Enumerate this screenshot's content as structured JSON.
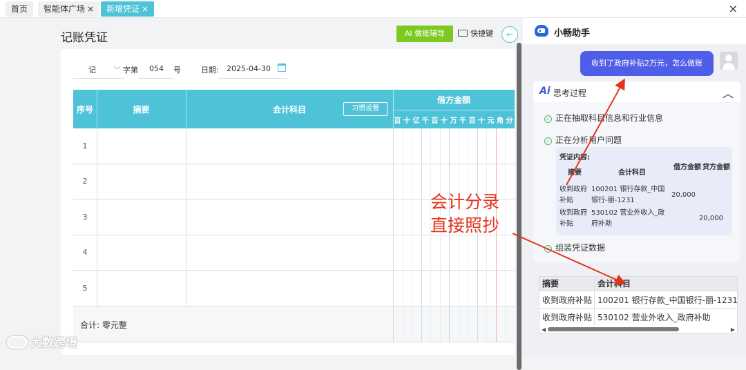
{
  "tabs": [
    {
      "label": "首页",
      "closable": false,
      "active": false
    },
    {
      "label": "智能体广场",
      "closable": true,
      "active": false
    },
    {
      "label": "新增凭证",
      "closable": true,
      "active": true
    }
  ],
  "tab_close_glyph": "×",
  "window_close_glyph": "×",
  "voucher": {
    "title": "记账凭证",
    "ai_button": "AI 做账辅导",
    "shortcut_button": "快捷键",
    "back_icon": "←",
    "word_type": "记",
    "word_label": "字第",
    "number": "054",
    "number_unit": "号",
    "date_label": "日期:",
    "date": "2025-04-30",
    "columns": {
      "seq": "序号",
      "summary": "摘要",
      "account": "会计科目",
      "habit_settings": "习惯设置",
      "debit": "借方金额",
      "digits": [
        "百",
        "十",
        "亿",
        "千",
        "百",
        "十",
        "万",
        "千",
        "百",
        "十",
        "元",
        "角",
        "分"
      ]
    },
    "rows": [
      "1",
      "2",
      "3",
      "4",
      "5"
    ],
    "total_label": "合计: 零元整"
  },
  "assistant": {
    "title": "小畅助手",
    "user_message": "收到了政府补贴2万元，怎么做账",
    "thinking_title": "思考过程",
    "ai_icon": "Ai",
    "collapse_icon": "︿",
    "check_glyph": "✓",
    "steps": [
      "正在抽取科目信息和行业信息",
      "正在分析用户问题",
      "组装凭证数据"
    ],
    "voucher_content_label": "凭证内容:",
    "voucher_headers": {
      "summary": "摘要",
      "account": "会计科目",
      "debit": "借方金额",
      "credit": "贷方金额"
    },
    "voucher_rows": [
      {
        "summary": "收到政府补贴",
        "account": "100201 银行存款_中国银行-丽-1231",
        "debit": "20,000",
        "credit": ""
      },
      {
        "summary": "收到政府补贴",
        "account": "530102 营业外收入_政府补助",
        "debit": "",
        "credit": "20,000"
      }
    ],
    "result_headers": {
      "summary": "摘要",
      "account": "会计科目"
    },
    "result_rows": [
      {
        "summary": "收到政府补贴",
        "account": "100201 银行存款_中国银行-丽-1231"
      },
      {
        "summary": "收到政府补贴",
        "account": "530102 营业外收入_政府补助"
      }
    ],
    "scroll_left": "◀",
    "scroll_right": "▶"
  },
  "annotation": {
    "line1": "会计分录",
    "line2": "直接照抄",
    "color": "#e5331b"
  },
  "watermark": "大数跨境",
  "colors": {
    "header_cyan": "#4ec3d8",
    "ai_green": "#7cc91f",
    "bubble_blue": "#4f5ee8",
    "check_green": "#52b26b"
  }
}
